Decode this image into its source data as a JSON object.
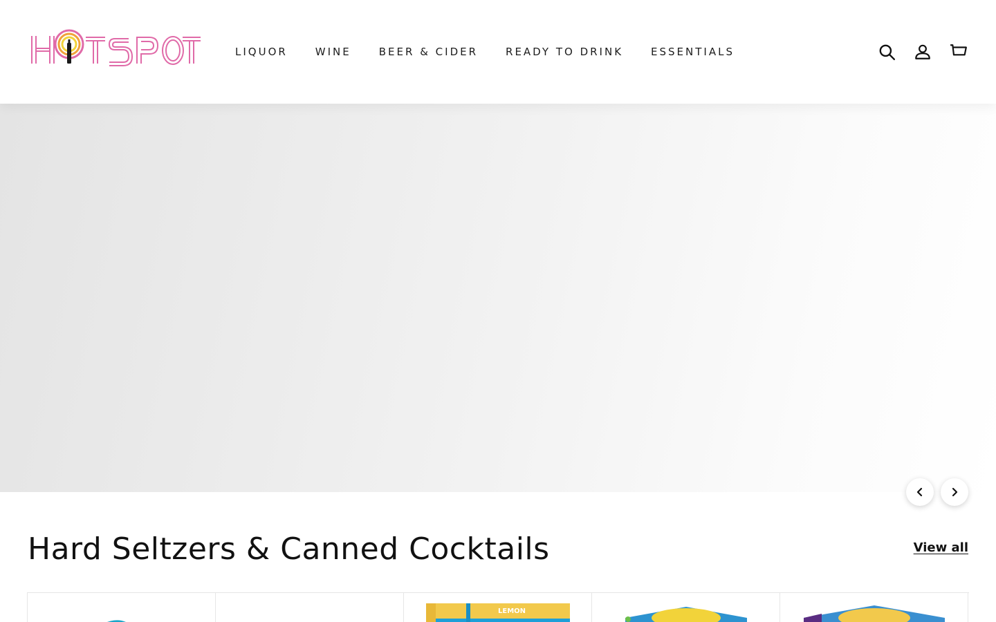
{
  "brand": {
    "name": "HOT SPOT",
    "primary_color": "#e06aa8",
    "accent_yellow": "#f2d33a",
    "accent_orange": "#f0a23a"
  },
  "nav": {
    "items": [
      {
        "label": "LIQUOR"
      },
      {
        "label": "WINE"
      },
      {
        "label": "BEER & CIDER"
      },
      {
        "label": "READY TO DRINK"
      },
      {
        "label": "ESSENTIALS"
      }
    ]
  },
  "header_icons": {
    "search": "search-icon",
    "account": "account-icon",
    "cart": "cart-icon"
  },
  "hero": {
    "prev_icon": "chevron-left-icon",
    "next_icon": "chevron-right-icon"
  },
  "section": {
    "title": "Hard Seltzers & Canned Cocktails",
    "view_all": "View all"
  },
  "products": [
    {
      "label": ""
    },
    {
      "label": ""
    },
    {
      "label": "LEMON"
    },
    {
      "label": ""
    },
    {
      "label": ""
    }
  ]
}
